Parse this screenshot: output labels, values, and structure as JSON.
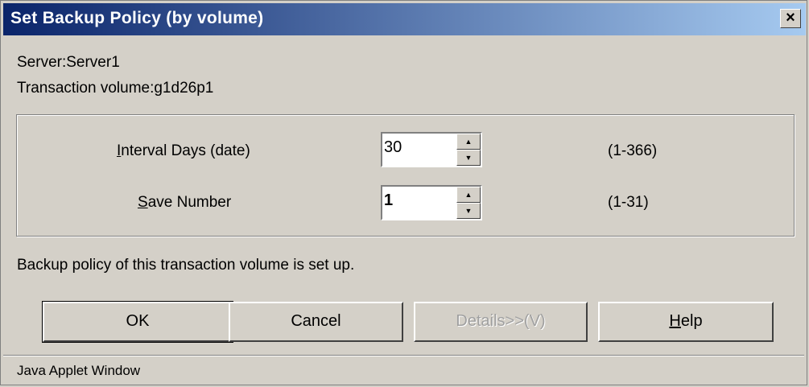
{
  "window": {
    "title": "Set Backup Policy (by volume)",
    "close_symbol": "×"
  },
  "info": {
    "server": "Server:Server1",
    "volume": "Transaction volume:g1d26p1"
  },
  "fields": [
    {
      "label_mnemonic": "I",
      "label_rest": "nterval Days (date)",
      "value": "30",
      "range": "(1-366)"
    },
    {
      "label_mnemonic": "S",
      "label_rest": "ave Number",
      "value": "1",
      "range": "(1-31)"
    }
  ],
  "status": "Backup policy of this transaction volume is set up.",
  "buttons": {
    "ok": "OK",
    "cancel": "Cancel",
    "details": "Details>>(V)",
    "help_mnemonic": "H",
    "help_rest": "elp"
  },
  "footer": "Java Applet Window"
}
